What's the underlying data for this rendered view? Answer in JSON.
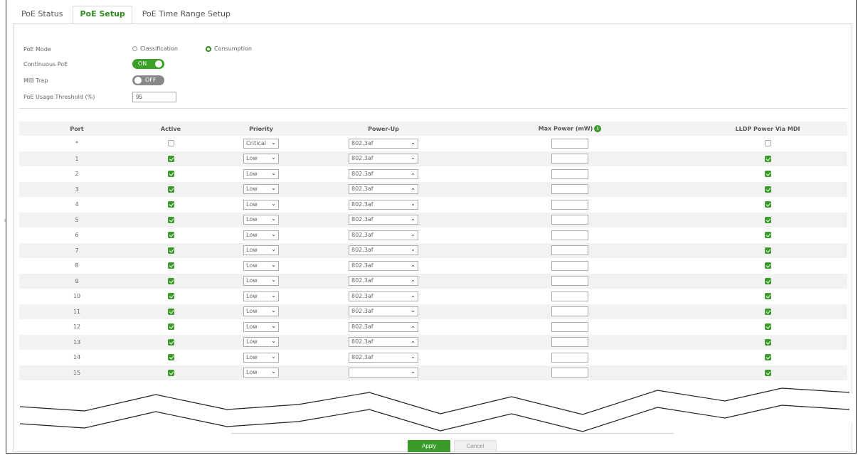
{
  "tabs": [
    {
      "label": "PoE Status",
      "active": false
    },
    {
      "label": "PoE Setup",
      "active": true
    },
    {
      "label": "PoE Time Range Setup",
      "active": false
    }
  ],
  "settings": {
    "poe_mode_label": "PoE Mode",
    "poe_mode_options": [
      "Classification",
      "Consumption"
    ],
    "poe_mode_selected": "Consumption",
    "continuous_poe_label": "Continuous PoE",
    "continuous_poe_state": "ON",
    "mib_trap_label": "MIB Trap",
    "mib_trap_state": "OFF",
    "usage_threshold_label": "PoE Usage Threshold (%)",
    "usage_threshold_value": "95"
  },
  "table": {
    "headers": [
      "Port",
      "Active",
      "Priority",
      "Power-Up",
      "Max Power (mW)",
      "LLDP Power Via MDI"
    ],
    "all_row": {
      "port": "*",
      "active": false,
      "priority": "Critical",
      "power_up": "802.3af",
      "lldp": false
    },
    "rows": [
      {
        "port": "1",
        "active": true,
        "priority": "Low",
        "power_up": "802.3af",
        "lldp": true
      },
      {
        "port": "2",
        "active": true,
        "priority": "Low",
        "power_up": "802.3af",
        "lldp": true
      },
      {
        "port": "3",
        "active": true,
        "priority": "Low",
        "power_up": "802.3af",
        "lldp": true
      },
      {
        "port": "4",
        "active": true,
        "priority": "Low",
        "power_up": "802.3af",
        "lldp": true
      },
      {
        "port": "5",
        "active": true,
        "priority": "Low",
        "power_up": "802.3af",
        "lldp": true
      },
      {
        "port": "6",
        "active": true,
        "priority": "Low",
        "power_up": "802.3af",
        "lldp": true
      },
      {
        "port": "7",
        "active": true,
        "priority": "Low",
        "power_up": "802.3af",
        "lldp": true
      },
      {
        "port": "8",
        "active": true,
        "priority": "Low",
        "power_up": "802.3af",
        "lldp": true
      },
      {
        "port": "9",
        "active": true,
        "priority": "Low",
        "power_up": "802.3af",
        "lldp": true
      },
      {
        "port": "10",
        "active": true,
        "priority": "Low",
        "power_up": "802.3af",
        "lldp": true
      },
      {
        "port": "11",
        "active": true,
        "priority": "Low",
        "power_up": "802.3af",
        "lldp": true
      },
      {
        "port": "12",
        "active": true,
        "priority": "Low",
        "power_up": "802.3af",
        "lldp": true
      },
      {
        "port": "13",
        "active": true,
        "priority": "Low",
        "power_up": "802.3af",
        "lldp": true
      },
      {
        "port": "14",
        "active": true,
        "priority": "Low",
        "power_up": "802.3af",
        "lldp": true
      },
      {
        "port": "15",
        "active": true,
        "priority": "Low",
        "power_up": "",
        "lldp": true
      }
    ]
  },
  "buttons": {
    "apply": "Apply",
    "cancel": "Cancel"
  },
  "icons": {
    "info": "info-icon",
    "collapse": "chevron-left-icon"
  },
  "colors": {
    "accent": "#3a9a2a",
    "tab_active": "#2e8b1e"
  }
}
